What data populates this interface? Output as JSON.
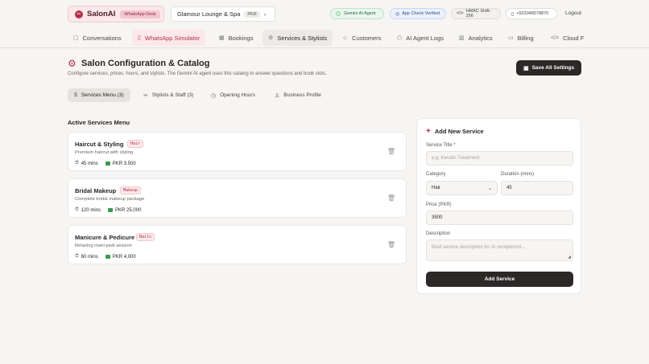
{
  "brand": {
    "name": "SalonAI",
    "badge": "WhatsApp Desk",
    "logo_icon": "scissors-icon"
  },
  "salon_selector": {
    "value": "Glamour Lounge & Spa",
    "currency": "PKR"
  },
  "status": {
    "gemini": "Gemini AI Agent",
    "app_check": "App Check Verified",
    "hmac": "HMAC SHA-256",
    "phone": "+923346578870"
  },
  "logout_label": "Logout",
  "nav": {
    "tabs": [
      {
        "label": "Conversations",
        "icon": "chat-icon"
      },
      {
        "label": "WhatsApp Simulator",
        "icon": "phone-icon"
      },
      {
        "label": "Bookings",
        "icon": "calendar-icon"
      },
      {
        "label": "Services & Stylists",
        "icon": "gear-icon"
      },
      {
        "label": "Customers",
        "icon": "users-icon"
      },
      {
        "label": "AI Agent Logs",
        "icon": "bot-icon"
      },
      {
        "label": "Analytics",
        "icon": "chart-icon"
      },
      {
        "label": "Billing",
        "icon": "card-icon"
      },
      {
        "label": "Cloud F",
        "icon": "code-icon"
      }
    ],
    "active": "Services & Stylists"
  },
  "page": {
    "title": "Salon Configuration & Catalog",
    "description": "Configure services, prices, hours, and stylists. The Gemini AI agent uses this catalog to answer questions and book slots.",
    "save_all_label": "Save All Settings"
  },
  "subtabs": [
    {
      "label": "Services Menu (3)",
      "icon": "dollar-icon"
    },
    {
      "label": "Stylists & Staff (3)",
      "icon": "scissors-icon"
    },
    {
      "label": "Opening Hours",
      "icon": "clock-icon"
    },
    {
      "label": "Business Profile",
      "icon": "user-icon"
    }
  ],
  "services_section_title": "Active Services Menu",
  "services": [
    {
      "name": "Haircut & Styling",
      "category": "Hair",
      "description": "Premium haircut with styling",
      "duration": "45 mins",
      "price": "PKR 3,500"
    },
    {
      "name": "Bridal Makeup",
      "category": "Makeup",
      "description": "Complete bridal makeup package",
      "duration": "120 mins",
      "price": "PKR 25,000"
    },
    {
      "name": "Manicure & Pedicure",
      "category": "Nails",
      "description": "Relaxing mani-pedi session",
      "duration": "60 mins",
      "price": "PKR 4,000"
    }
  ],
  "add_form": {
    "title": "Add New Service",
    "service_title_label": "Service Title *",
    "service_title_placeholder": "e.g. Keratin Treatment",
    "category_label": "Category",
    "category_value": "Hair",
    "duration_label": "Duration (mins)",
    "duration_value": "45",
    "price_label": "Price (PKR)",
    "price_value": "3500",
    "description_label": "Description",
    "description_placeholder": "Brief service description for AI receptionist...",
    "submit_label": "Add Service"
  },
  "colors": {
    "accent": "#b3304a",
    "dark_button": "#2b2827",
    "background": "#f6f5f3"
  }
}
